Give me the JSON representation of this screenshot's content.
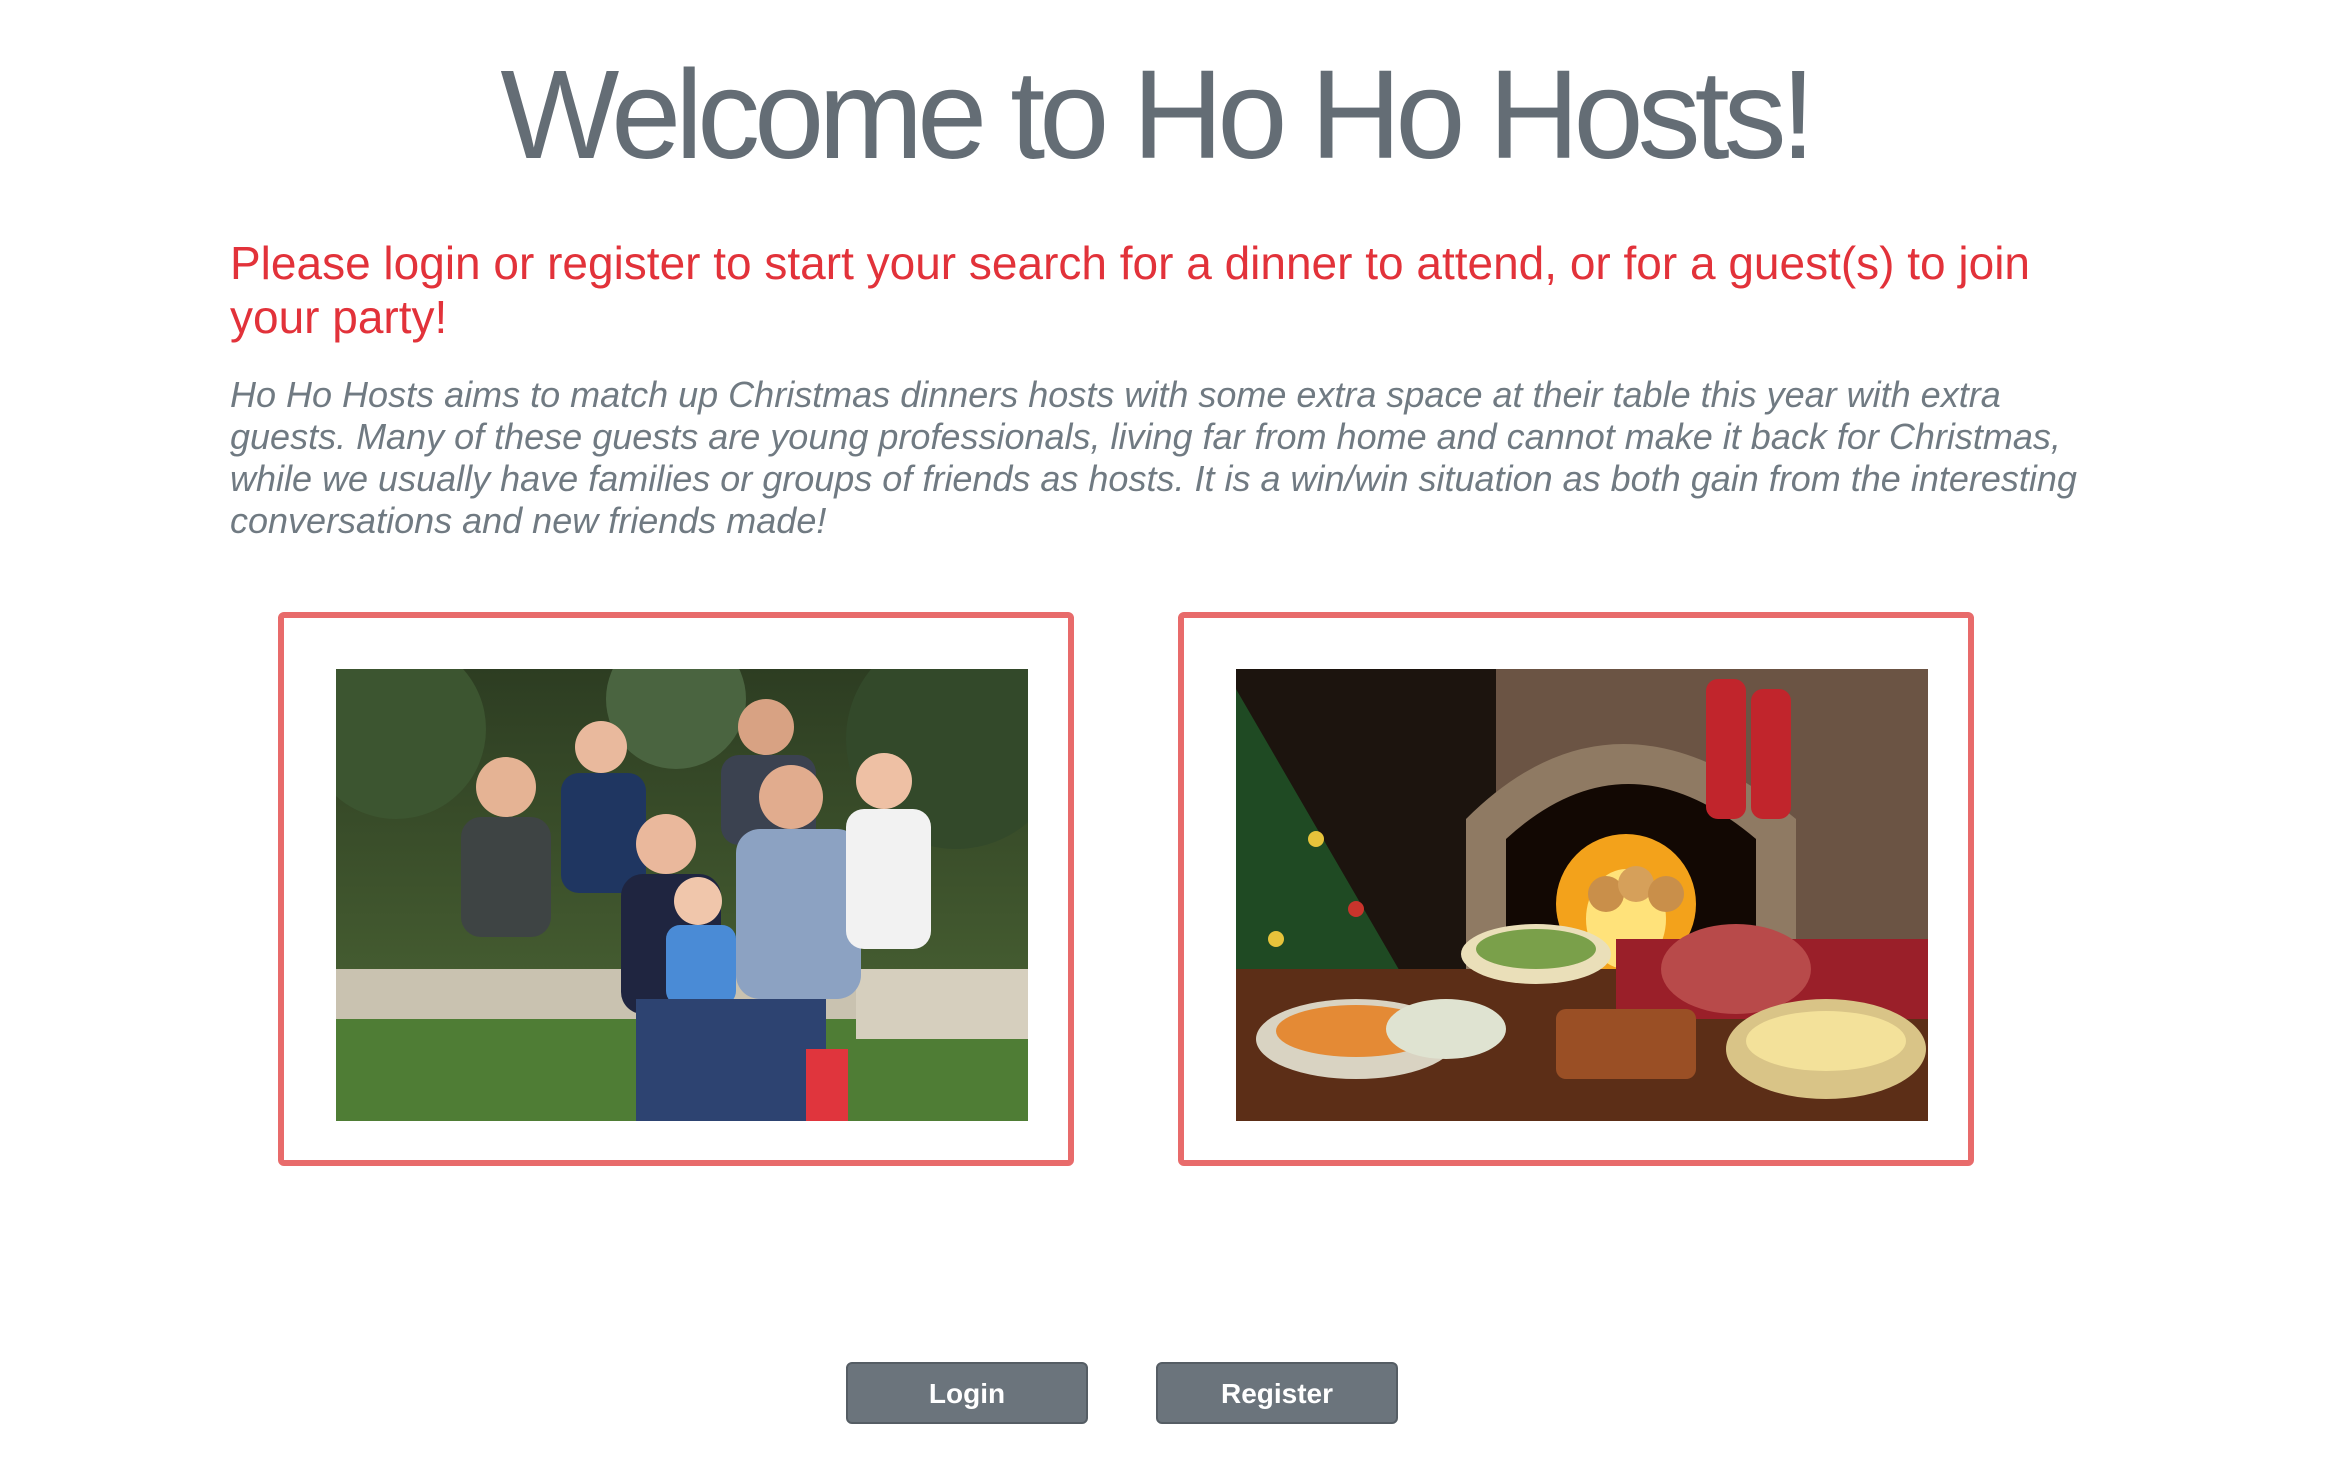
{
  "page": {
    "title": "Welcome to Ho Ho Hosts!",
    "intro_heading": "Please login or register to start your search for a dinner to attend, or for a guest(s) to join your party!",
    "intro_text": "Ho Ho Hosts aims to match up Christmas dinners hosts with some extra space at their table this year with extra guests. Many of these guests are young professionals, living far from home and cannot make it back for Christmas, while we usually have families or groups of friends as hosts. It is a win/win situation as both gain from the interesting conversations and new friends made!"
  },
  "photos": [
    {
      "subject": "family-group-outdoors"
    },
    {
      "subject": "christmas-dinner-fireplace"
    }
  ],
  "actions": {
    "login_label": "Login",
    "register_label": "Register"
  },
  "colors": {
    "title": "#646d75",
    "heading_red": "#e2323a",
    "body_grey": "#707a82",
    "card_border": "#e86b6b",
    "button_bg": "#6b747c"
  }
}
